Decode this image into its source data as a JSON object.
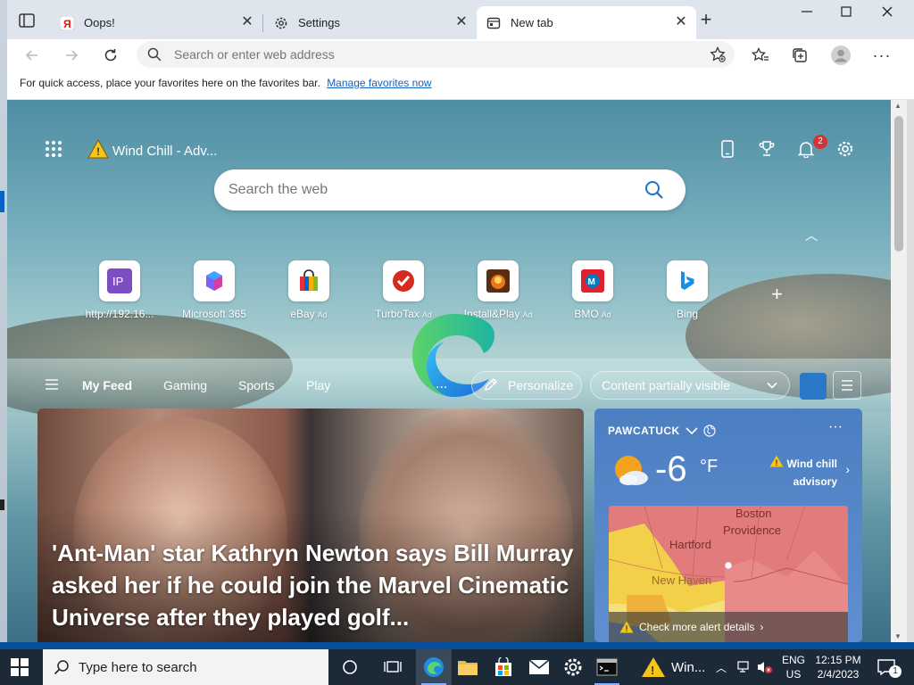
{
  "browser": {
    "tabs": [
      {
        "title": "Oops!",
        "icon": "yandex-icon"
      },
      {
        "title": "Settings",
        "icon": "gear-icon"
      },
      {
        "title": "New tab",
        "icon": "newtab-icon"
      }
    ],
    "address_placeholder": "Search or enter web address",
    "favorites_bar_text": "For quick access, place your favorites here on the favorites bar.",
    "favorites_bar_link": "Manage favorites now"
  },
  "newtab": {
    "weather_chip": "Wind Chill - Adv...",
    "notifications_count": "2",
    "search_placeholder": "Search the web",
    "quick_links": [
      {
        "label": "http://192.16...",
        "ad": "",
        "icon": "ip-icon"
      },
      {
        "label": "Microsoft 365",
        "ad": "",
        "icon": "microsoft365-icon"
      },
      {
        "label": "eBay",
        "ad": "Ad",
        "icon": "ebay-icon"
      },
      {
        "label": "TurboTax",
        "ad": "Ad",
        "icon": "turbotax-icon"
      },
      {
        "label": "Install&Play",
        "ad": "Ad",
        "icon": "game-icon"
      },
      {
        "label": "BMO",
        "ad": "Ad",
        "icon": "bmo-icon"
      },
      {
        "label": "Bing",
        "ad": "",
        "icon": "bing-icon"
      }
    ],
    "feed_tabs": [
      "My Feed",
      "Gaming",
      "Sports",
      "Play"
    ],
    "feed_more": "...",
    "personalize": "Personalize",
    "content_visibility": "Content partially visible",
    "hero_headline": "'Ant-Man' star Kathryn Newton says Bill Murray asked her if he could join the Marvel Cinematic Universe after they played golf...",
    "weather": {
      "location": "PAWCATUCK",
      "temperature": "-6",
      "unit": "°F",
      "advisory_line1": "Wind chill",
      "advisory_line2": "advisory",
      "map_labels": [
        "Boston",
        "Providence",
        "Hartford",
        "New Haven"
      ],
      "alert_link": "Check more alert details"
    }
  },
  "taskbar": {
    "search_placeholder": "Type here to search",
    "weather_label": "Win...",
    "language_line1": "ENG",
    "language_line2": "US",
    "time": "12:15 PM",
    "date": "2/4/2023",
    "action_center_count": "1"
  },
  "colors": {
    "accent": "#0067c0",
    "taskbar": "#1c2a38",
    "weather_card": "#4c7fc2",
    "badge": "#d13438"
  }
}
